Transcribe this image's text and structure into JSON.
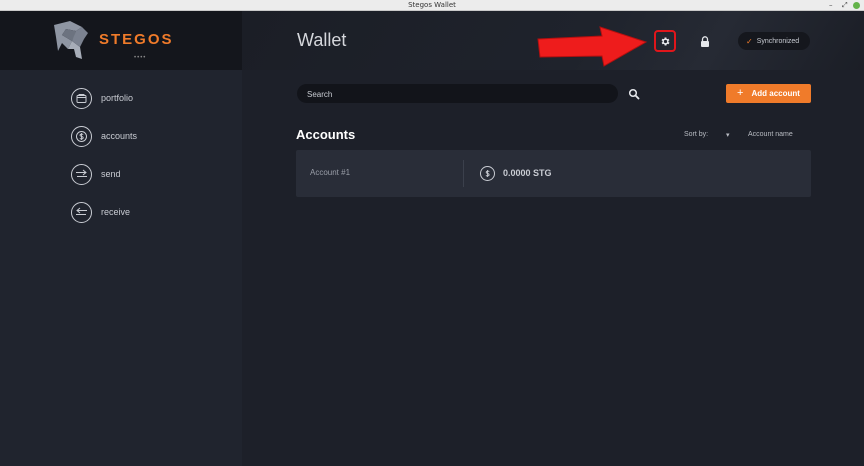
{
  "window": {
    "title": "Stegos Wallet",
    "controls": [
      "–",
      "⤢"
    ]
  },
  "brand": {
    "name": "STEGOS",
    "dots": "••••",
    "accent": "#f07b2a"
  },
  "sidebar": {
    "items": [
      {
        "label": "portfolio",
        "icon": "portfolio-icon"
      },
      {
        "label": "accounts",
        "icon": "accounts-icon"
      },
      {
        "label": "send",
        "icon": "send-icon"
      },
      {
        "label": "receive",
        "icon": "receive-icon"
      }
    ]
  },
  "header": {
    "title": "Wallet",
    "settings_icon": "gear-icon",
    "lock_icon": "lock-icon",
    "sync_status": "Synchronized",
    "sync_check": "✓"
  },
  "toolbar": {
    "search_placeholder": "Search",
    "add_label": "Add account",
    "add_plus": "+"
  },
  "accounts": {
    "title": "Accounts",
    "sort_label": "Sort by:",
    "sort_caret": "▾",
    "sort_value": "Account name",
    "items": [
      {
        "name": "Account #1",
        "balance": "0.0000 STG"
      }
    ]
  },
  "annotation": {
    "color": "#e0161b"
  }
}
